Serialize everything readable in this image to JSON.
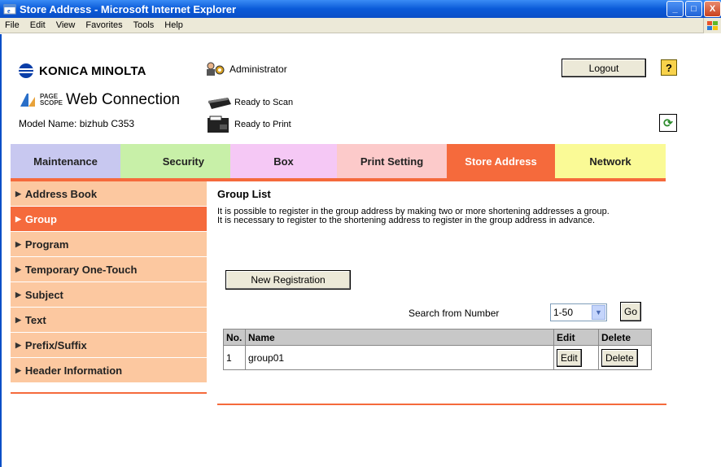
{
  "window": {
    "title": "Store Address - Microsoft Internet Explorer",
    "buttons": {
      "minimize": "_",
      "maximize": "□",
      "close": "X"
    }
  },
  "menu": [
    "File",
    "Edit",
    "View",
    "Favorites",
    "Tools",
    "Help"
  ],
  "header": {
    "brand": "KONICA MINOLTA",
    "product_prefix": "PAGE SCOPE",
    "product": "Web Connection",
    "model": "Model Name: bizhub C353",
    "user": "Administrator",
    "scan_status": "Ready to Scan",
    "print_status": "Ready to Print",
    "logout_label": "Logout",
    "help_label": "?"
  },
  "tabs": [
    {
      "label": "Maintenance",
      "color": "#c8c8f0"
    },
    {
      "label": "Security",
      "color": "#c8f0a8"
    },
    {
      "label": "Box",
      "color": "#f5c8f5"
    },
    {
      "label": "Print Setting",
      "color": "#fccaca"
    },
    {
      "label": "Store Address",
      "color": "#f56a3c",
      "active": true
    },
    {
      "label": "Network",
      "color": "#fafa96"
    }
  ],
  "sidebar": {
    "items": [
      {
        "label": "Address Book"
      },
      {
        "label": "Group",
        "active": true
      },
      {
        "label": "Program"
      },
      {
        "label": "Temporary One-Touch"
      },
      {
        "label": "Subject"
      },
      {
        "label": "Text"
      },
      {
        "label": "Prefix/Suffix"
      },
      {
        "label": "Header Information"
      }
    ]
  },
  "main": {
    "title": "Group List",
    "description_1": "It is possible to register in the group address by making two or more shortening addresses a group.",
    "description_2": "It is necessary to register to the shortening address to register in the group address in advance.",
    "new_registration_label": "New Registration",
    "search_label": "Search from Number",
    "search_range": "1-50",
    "go_label": "Go",
    "table": {
      "headers": [
        "No.",
        "Name",
        "Edit",
        "Delete"
      ],
      "rows": [
        {
          "no": "1",
          "name": "group01",
          "edit_label": "Edit",
          "delete_label": "Delete"
        }
      ]
    }
  },
  "colors": {
    "accent": "#f56a3c",
    "nav_bg": "#fcc8a0"
  }
}
